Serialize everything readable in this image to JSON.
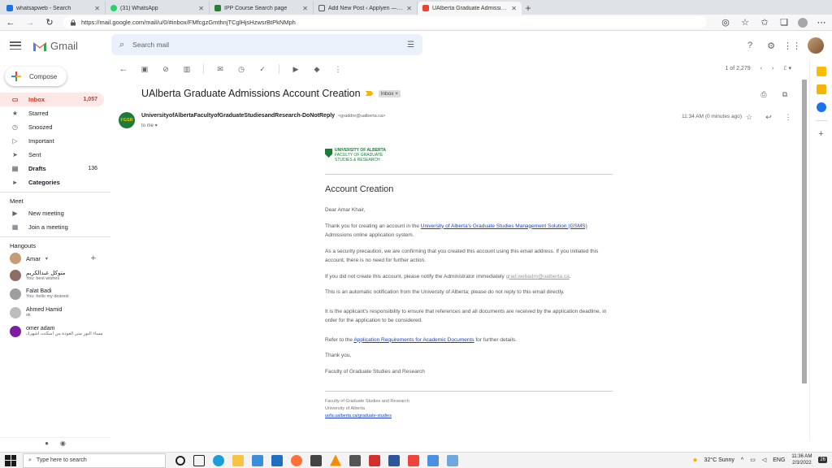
{
  "browser": {
    "tabs": [
      {
        "label": "whatsapweb - Search",
        "color": "#1a73e8"
      },
      {
        "label": "(31) WhatsApp",
        "color": "#25d366"
      },
      {
        "label": "IPP Course Search page",
        "color": "#2e7d32"
      },
      {
        "label": "Add New Post ‹ Applyen — Wo…",
        "color": "#555555"
      },
      {
        "label": "UAlberta Graduate Admissions A",
        "color": "#ea4335"
      }
    ],
    "url": "https://mail.google.com/mail/u/0/#inbox/FMfcgzGmthnjTCglHjsHzwsrBtPkNMph"
  },
  "gmail": {
    "logo_text": "Gmail",
    "search_placeholder": "Search mail",
    "compose_label": "Compose",
    "nav": [
      {
        "label": "Inbox",
        "count": "1,057",
        "icon": "inbox-icon"
      },
      {
        "label": "Starred",
        "count": "",
        "icon": "star-icon"
      },
      {
        "label": "Snoozed",
        "count": "",
        "icon": "clock-icon"
      },
      {
        "label": "Important",
        "count": "",
        "icon": "important-icon"
      },
      {
        "label": "Sent",
        "count": "",
        "icon": "send-icon"
      },
      {
        "label": "Drafts",
        "count": "136",
        "icon": "draft-icon"
      },
      {
        "label": "Categories",
        "count": "",
        "icon": "label-icon"
      }
    ],
    "meet": {
      "title": "Meet",
      "items": [
        "New meeting",
        "Join a meeting"
      ]
    },
    "hangouts": {
      "title": "Hangouts",
      "user": "Amar",
      "contacts": [
        {
          "name": "متوكل عبدالكريم",
          "sub": "You: best wishes",
          "color": "#8d6e63"
        },
        {
          "name": "Falat Badi",
          "sub": "You: hello my dearest",
          "color": "#9e9e9e"
        },
        {
          "name": "Ahmed Hamid",
          "sub": "ok",
          "color": "#bdbdbd"
        },
        {
          "name": "omer adam",
          "sub": "مساء النور متى العودة من اسكتت اشهرك",
          "color": "#7b1fa2"
        }
      ]
    },
    "pager": "1 of 2,279",
    "message": {
      "subject": "UAlberta Graduate Admissions Account Creation",
      "label": "Inbox",
      "sender_initials": "FGSR",
      "sender_name": "UniversityofAlbertaFacultyofGraduateStudiesandResearch-DoNotReply",
      "sender_email": "<graddnr@ualberta.ca>",
      "to": "to me",
      "time": "11:34 AM (0 minutes ago)"
    },
    "email": {
      "logo_line1": "UNIVERSITY OF ALBERTA",
      "logo_line2": "FACULTY OF GRADUATE",
      "logo_line3": "STUDIES & RESEARCH",
      "title": "Account Creation",
      "greeting": "Dear Amar Khair,",
      "p1_before": "Thank you for creating an account in the ",
      "p1_link": "University of Alberta's Graduate Studies Management Solution (GSMS)",
      "p1_after": " Admissions online application system.",
      "p2": "As a security precaution, we are confirming that you created this account using this email address. If you initiated this account, there is no need for further action.",
      "p3_before": "If you did not create this account, please notify the Administrator immediately ",
      "p3_link": "grad.webadm@ualberta.ca",
      "p3_after": ".",
      "p4": "This is an automatic notification from the University of Alberta; please do not reply to this email directly.",
      "p5": "It is the applicant's responsibility to ensure that references and all documents are received by the application deadline, in order for the application to be considered.",
      "p6_before": "Refer to the ",
      "p6_link": "Application Requirements for Academic Documents",
      "p6_after": " for further details.",
      "closing": "Thank you,",
      "signature": "Faculty of Graduate Studies and Research",
      "footer1": "Faculty of Graduate Studies and Research",
      "footer2": "University of Alberta",
      "footer_link": "uofa.ualberta.ca/graduate-studies"
    }
  },
  "taskbar": {
    "search_placeholder": "Type here to search",
    "weather": "32°C  Sunny",
    "lang": "ENG",
    "time": "11:36 AM",
    "date": "2/3/2022",
    "notification_count": "26"
  }
}
